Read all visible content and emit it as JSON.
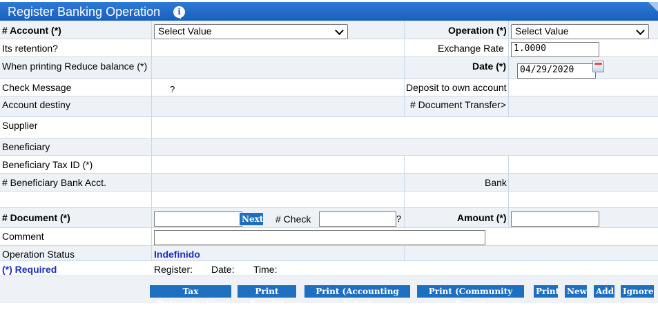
{
  "window": {
    "title": "Register Banking Operation",
    "info_icon": "info-icon"
  },
  "form": {
    "account_label": "# Account (*)",
    "account_value": "Select Value",
    "operation_label": "Operation (*)",
    "operation_value": "Select Value",
    "retention_label": "Its retention?",
    "exchange_rate_label": "Exchange Rate",
    "exchange_rate_value": "1.0000",
    "reduce_balance_label": "When printing Reduce balance (*)",
    "date_label": "Date (*)",
    "date_value": "04/29/2020",
    "check_message_label": "Check Message",
    "check_message_value": "?",
    "deposit_label": "Deposit to own account",
    "account_destiny_label": "Account destiny",
    "doc_transfer_label": "# Document Transfer>",
    "supplier_label": "Supplier",
    "beneficiary_label": "Beneficiary",
    "beneficiary_tax_label": "Beneficiary Tax ID (*)",
    "beneficiary_bank_label": "# Beneficiary Bank Acct.",
    "bank_label": "Bank",
    "document_label": "# Document (*)",
    "next_label": "Next",
    "check_label": "# Check",
    "check_q": "?",
    "amount_label": "Amount (*)",
    "comment_label": "Comment",
    "status_label": "Operation Status",
    "status_value": "Indefinido",
    "required_label": "(*) Required",
    "register_label": "Register:",
    "date_info_label": "Date:",
    "time_label": "Time:"
  },
  "buttons": {
    "tax": "Tax Determination",
    "receipt": "Print Receipt",
    "accounting": "Print (Accounting Entry)",
    "community": "Print (Community Paper)",
    "print": "Print",
    "new": "New",
    "add": "Add",
    "ignore": "Ignore"
  }
}
